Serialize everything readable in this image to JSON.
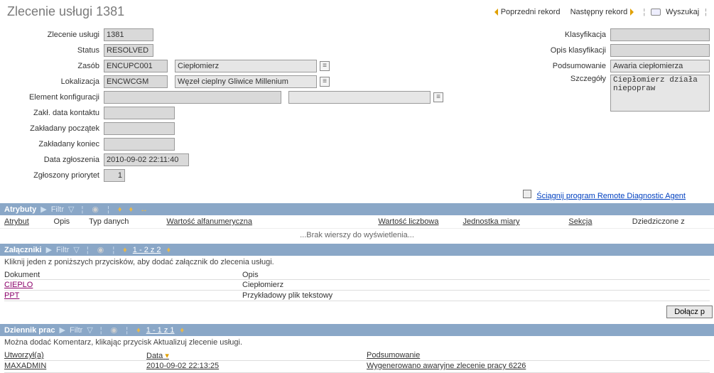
{
  "header": {
    "title": "Zlecenie usługi 1381",
    "prev": "Poprzedni rekord",
    "next": "Następny rekord",
    "search": "Wyszukaj"
  },
  "form": {
    "left": {
      "sr_lbl": "Zlecenie usługi",
      "sr_val": "1381",
      "status_lbl": "Status",
      "status_val": "RESOLVED",
      "asset_lbl": "Zasób",
      "asset_val": "ENCUPC001",
      "asset_desc": "Ciepłomierz",
      "loc_lbl": "Lokalizacja",
      "loc_val": "ENCWCGM",
      "loc_desc": "Węzeł cieplny Gliwice Millenium",
      "ci_lbl": "Element konfiguracji",
      "ci_val": "",
      "ci_desc": "",
      "contact_lbl": "Zakł. data kontaktu",
      "contact_val": "",
      "pstart_lbl": "Zakładany początek",
      "pstart_val": "",
      "pend_lbl": "Zakładany koniec",
      "pend_val": "",
      "reported_lbl": "Data zgłoszenia",
      "reported_val": "2010-09-02 22:11:40",
      "prio_lbl": "Zgłoszony priorytet",
      "prio_val": "1"
    },
    "right": {
      "class_lbl": "Klasyfikacja",
      "class_val": "",
      "classdesc_lbl": "Opis klasyfikacji",
      "classdesc_val": "",
      "summary_lbl": "Podsumowanie",
      "summary_val": "Awaria ciepłomierza",
      "details_lbl": "Szczegóły",
      "details_val": "Ciepłomierz działa niepopraw"
    },
    "rdas": "Ściągnij program Remote Diagnostic Agent"
  },
  "atrybuty": {
    "title": "Atrybuty",
    "filter": "Filtr",
    "cols": {
      "attr": "Atrybut",
      "opis": "Opis",
      "typ": "Typ danych",
      "alpha": "Wartość alfanumeryczna",
      "num": "Wartość liczbowa",
      "uom": "Jednostka miary",
      "sekcja": "Sekcja",
      "inherit": "Dziedziczone z"
    },
    "norows": "...Brak wierszy do wyświetlenia..."
  },
  "zalaczniki": {
    "title": "Załączniki",
    "filter": "Filtr",
    "pager": "1 - 2 z 2",
    "help": "Kliknij jeden z poniższych przycisków, aby dodać załącznik do zlecenia usługi.",
    "doc_h": "Dokument",
    "opis_h": "Opis",
    "rows": [
      {
        "doc": "CIEPLO",
        "opis": "Ciepłomierz"
      },
      {
        "doc": "PPT",
        "opis": "Przykładowy plik tekstowy"
      }
    ],
    "attach_btn": "Dołącz p"
  },
  "dziennik": {
    "title": "Dziennik prac",
    "filter": "Filtr",
    "pager": "1 - 1 z 1",
    "help": "Można dodać Komentarz, klikając przycisk Aktualizuj zlecenie usługi.",
    "cols": {
      "by": "Utworzył(a)",
      "date": "Data",
      "sum": "Podsumowanie"
    },
    "rows": [
      {
        "by": "MAXADMIN",
        "date": "2010-09-02 22:13:25",
        "sum": "Wygenerowano awaryjne zlecenie pracy 6226"
      }
    ]
  }
}
